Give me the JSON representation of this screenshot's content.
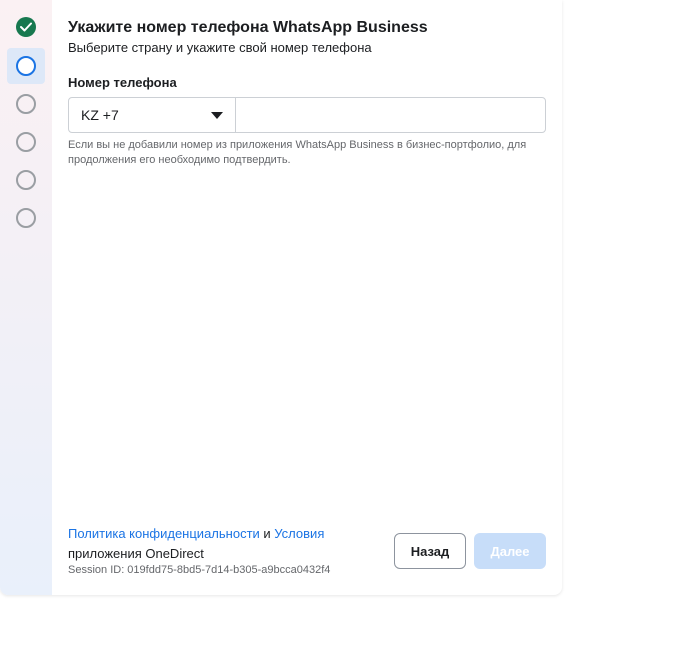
{
  "stepper": {
    "steps": [
      {
        "state": "done",
        "icon": "check-icon"
      },
      {
        "state": "current"
      },
      {
        "state": "pending"
      },
      {
        "state": "pending"
      },
      {
        "state": "pending"
      },
      {
        "state": "pending"
      }
    ],
    "colors": {
      "done": "#17784f",
      "current": "#1b74e4",
      "pending": "#9a9ea3"
    }
  },
  "header": {
    "title": "Укажите номер телефона WhatsApp Business",
    "subtitle": "Выберите страну и укажите свой номер телефона"
  },
  "phone": {
    "label": "Номер телефона",
    "country_selected": "KZ +7",
    "value": "",
    "hint": "Если вы не добавили номер из приложения WhatsApp Business в бизнес-портфолио, для продолжения его необходимо подтвердить."
  },
  "footer": {
    "privacy_link": "Политика конфиденциальности",
    "and_text": " и ",
    "terms_link": "Условия",
    "app_text": "приложения OneDirect",
    "session_id": "Session ID: 019fdd75-8bd5-7d14-b305-a9bcca0432f4",
    "back_label": "Назад",
    "next_label": "Далее"
  },
  "colors": {
    "link": "#1b74e4",
    "next_disabled": "#c7ddf9"
  }
}
